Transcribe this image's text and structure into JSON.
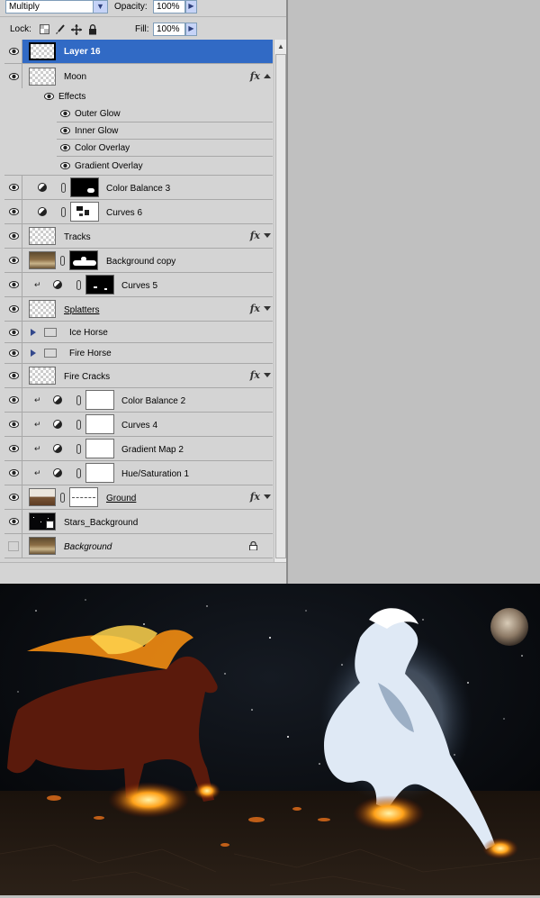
{
  "blend_mode": "Multiply",
  "opacity_label": "Opacity:",
  "opacity_value": "100%",
  "lock_label": "Lock:",
  "fill_label": "Fill:",
  "fill_value": "100%",
  "layers": {
    "layer16": "Layer 16",
    "moon": "Moon",
    "effects": "Effects",
    "outer_glow": "Outer Glow",
    "inner_glow": "Inner Glow",
    "color_overlay": "Color Overlay",
    "gradient_overlay": "Gradient Overlay",
    "color_balance3": "Color Balance 3",
    "curves6": "Curves 6",
    "tracks": "Tracks",
    "bg_copy": "Background copy",
    "curves5": "Curves 5",
    "splatters": "Splatters",
    "ice_horse": "Ice Horse",
    "fire_horse": "Fire Horse",
    "fire_cracks": "Fire Cracks",
    "color_balance2": "Color Balance 2",
    "curves4": "Curves 4",
    "gradient_map2": "Gradient Map 2",
    "hue_sat1": "Hue/Saturation 1",
    "ground": "Ground",
    "stars_bg": "Stars_Background",
    "background": "Background"
  },
  "fx_label": "fx",
  "colors": {
    "selection": "#316ac5",
    "panel": "#d4d4d4",
    "canvas_bg": "#c0c0c0"
  }
}
